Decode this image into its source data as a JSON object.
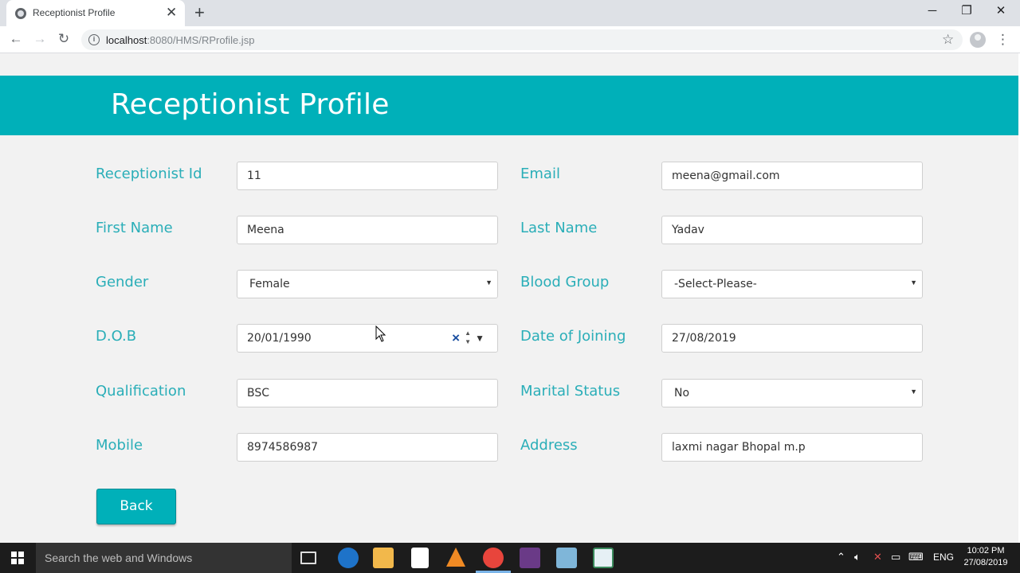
{
  "browser": {
    "tab_title": "Receptionist Profile",
    "tab_close": "✕",
    "new_tab": "+",
    "url_host": "localhost",
    "url_rest": ":8080/HMS/RProfile.jsp",
    "window_controls": {
      "minimize": "─",
      "restore": "❐",
      "close": "✕"
    }
  },
  "page": {
    "title": "Receptionist Profile",
    "fields": {
      "receptionist_id": {
        "label": "Receptionist Id",
        "value": "11"
      },
      "email": {
        "label": "Email",
        "value": "meena@gmail.com"
      },
      "first_name": {
        "label": "First Name",
        "value": "Meena"
      },
      "last_name": {
        "label": "Last Name",
        "value": "Yadav"
      },
      "gender": {
        "label": "Gender",
        "value": "Female"
      },
      "blood_group": {
        "label": "Blood Group",
        "value": "-Select-Please-"
      },
      "dob": {
        "label": "D.O.B",
        "value": "20/01/1990"
      },
      "date_of_joining": {
        "label": "Date of Joining",
        "value": "27/08/2019"
      },
      "qualification": {
        "label": "Qualification",
        "value": "BSC"
      },
      "marital_status": {
        "label": "Marital Status",
        "value": "No"
      },
      "mobile": {
        "label": "Mobile",
        "value": "8974586987"
      },
      "address": {
        "label": "Address",
        "value": "laxmi nagar Bhopal m.p"
      }
    },
    "back_label": "Back",
    "accent_color": "#00b0b9"
  },
  "taskbar": {
    "search_placeholder": "Search the web and Windows",
    "language": "ENG",
    "time": "10:02 PM",
    "date": "27/08/2019"
  }
}
